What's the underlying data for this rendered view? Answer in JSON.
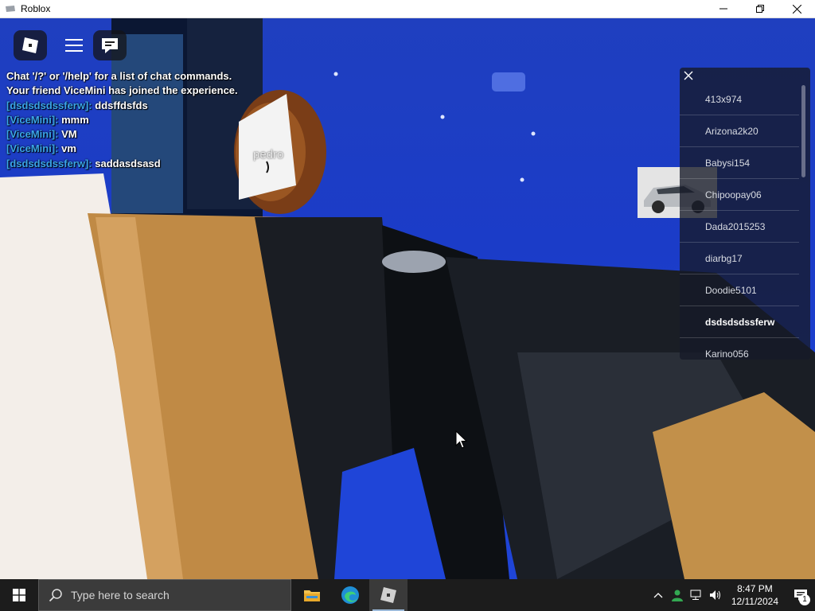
{
  "window": {
    "title": "Roblox",
    "controls": [
      "minimize-icon",
      "restore-icon",
      "close-icon"
    ]
  },
  "hud": {
    "buttons": [
      "roblox-logo-icon",
      "menu-icon",
      "chat-icon"
    ]
  },
  "chat": {
    "lines": [
      {
        "who": "",
        "text": "Chat '/?' or '/help' for a list of chat commands."
      },
      {
        "who": "",
        "text": "Your friend ViceMini has joined the experience."
      },
      {
        "who": "[dsdsdsdssferw]:",
        "text": "ddsffdsfds"
      },
      {
        "who": "[ViceMini]:",
        "text": "mmm"
      },
      {
        "who": "[ViceMini]:",
        "text": "VM"
      },
      {
        "who": "[ViceMini]:",
        "text": "vm"
      },
      {
        "who": "[dsdsdsdssferw]:",
        "text": "saddasdsasd"
      }
    ],
    "name_color": "#3aa5e8"
  },
  "world": {
    "nametag": "pedro"
  },
  "player_list": {
    "players": [
      "413x974",
      "Arizona2k20",
      "Babysi154",
      "Chipoopay06",
      "Dada2015253",
      "diarbg17",
      "Doodie5101",
      "dsdsdsdssferw",
      "Karino056"
    ],
    "local_player": "dsdsdsdssferw"
  },
  "taskbar": {
    "search_placeholder": "Type here to search",
    "apps": [
      "file-explorer-icon",
      "edge-icon",
      "roblox-icon"
    ],
    "time": "8:47 PM",
    "date": "12/11/2024",
    "notification_count": "1"
  },
  "colors": {
    "sky": "#1f45d8",
    "taskbar": "#1c1c1c"
  }
}
